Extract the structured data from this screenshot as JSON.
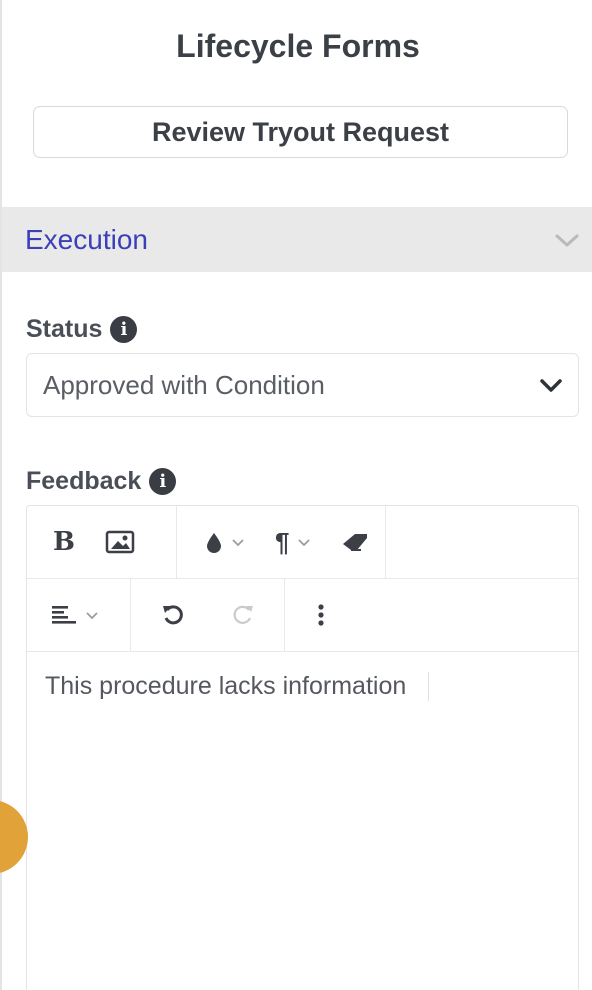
{
  "panel": {
    "title": "Lifecycle Forms",
    "review_button_label": "Review Tryout Request"
  },
  "section": {
    "title": "Execution",
    "accent_color": "#3b3fb8"
  },
  "status": {
    "label": "Status",
    "selected_value": "Approved with Condition"
  },
  "feedback": {
    "label": "Feedback",
    "content": "This procedure lacks information",
    "toolbar": {
      "row1": [
        "bold-icon",
        "image-icon",
        "color-drop-icon",
        "paragraph-icon",
        "eraser-icon"
      ],
      "row2": [
        "align-icon",
        "undo-icon",
        "redo-icon",
        "more-vertical-icon"
      ]
    }
  },
  "colors": {
    "fab": "#e2a23a",
    "header_bg": "#e9e9ea"
  }
}
